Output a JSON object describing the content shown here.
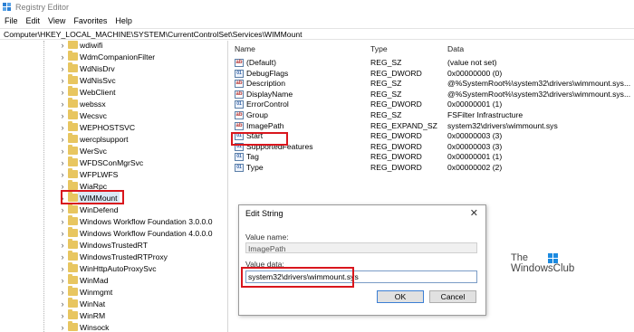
{
  "window": {
    "title": "Registry Editor"
  },
  "menu": [
    "File",
    "Edit",
    "View",
    "Favorites",
    "Help"
  ],
  "address": "Computer\\HKEY_LOCAL_MACHINE\\SYSTEM\\CurrentControlSet\\Services\\WIMMount",
  "tree": {
    "items": [
      "wdiwifi",
      "WdmCompanionFilter",
      "WdNisDrv",
      "WdNisSvc",
      "WebClient",
      "webssx",
      "Wecsvc",
      "WEPHOSTSVC",
      "wercplsupport",
      "WerSvc",
      "WFDSConMgrSvc",
      "WFPLWFS",
      "WiaRpc",
      "WIMMount",
      "WinDefend",
      "Windows Workflow Foundation 3.0.0.0",
      "Windows Workflow Foundation 4.0.0.0",
      "WindowsTrustedRT",
      "WindowsTrustedRTProxy",
      "WinHttpAutoProxySvc",
      "WinMad",
      "Winmgmt",
      "WinNat",
      "WinRM",
      "Winsock"
    ],
    "selected": "WIMMount"
  },
  "list": {
    "headers": {
      "name": "Name",
      "type": "Type",
      "data": "Data"
    },
    "rows": [
      {
        "name": "(Default)",
        "type": "REG_SZ",
        "data": "(value not set)",
        "icon": "string-value-icon"
      },
      {
        "name": "DebugFlags",
        "type": "REG_DWORD",
        "data": "0x00000000 (0)",
        "icon": "binary-value-icon"
      },
      {
        "name": "Description",
        "type": "REG_SZ",
        "data": "@%SystemRoot%\\system32\\drivers\\wimmount.sys...",
        "icon": "string-value-icon"
      },
      {
        "name": "DisplayName",
        "type": "REG_SZ",
        "data": "@%SystemRoot%\\system32\\drivers\\wimmount.sys...",
        "icon": "string-value-icon"
      },
      {
        "name": "ErrorControl",
        "type": "REG_DWORD",
        "data": "0x00000001 (1)",
        "icon": "binary-value-icon"
      },
      {
        "name": "Group",
        "type": "REG_SZ",
        "data": "FSFilter Infrastructure",
        "icon": "string-value-icon"
      },
      {
        "name": "ImagePath",
        "type": "REG_EXPAND_SZ",
        "data": "system32\\drivers\\wimmount.sys",
        "icon": "string-value-icon"
      },
      {
        "name": "Start",
        "type": "REG_DWORD",
        "data": "0x00000003 (3)",
        "icon": "binary-value-icon"
      },
      {
        "name": "SupportedFeatures",
        "type": "REG_DWORD",
        "data": "0x00000003 (3)",
        "icon": "binary-value-icon"
      },
      {
        "name": "Tag",
        "type": "REG_DWORD",
        "data": "0x00000001 (1)",
        "icon": "binary-value-icon"
      },
      {
        "name": "Type",
        "type": "REG_DWORD",
        "data": "0x00000002 (2)",
        "icon": "binary-value-icon"
      }
    ]
  },
  "dialog": {
    "title": "Edit String",
    "close": "✕",
    "value_name_label": "Value name:",
    "value_name": "ImagePath",
    "value_data_label": "Value data:",
    "value_data": "system32\\drivers\\wimmount.sys",
    "ok": "OK",
    "cancel": "Cancel"
  },
  "watermark": {
    "line1": "The",
    "line2": "WindowsClub"
  },
  "colors": {
    "highlight_red": "#d9161d",
    "folder": "#e8c660",
    "accent_blue": "#2a7fd4"
  }
}
